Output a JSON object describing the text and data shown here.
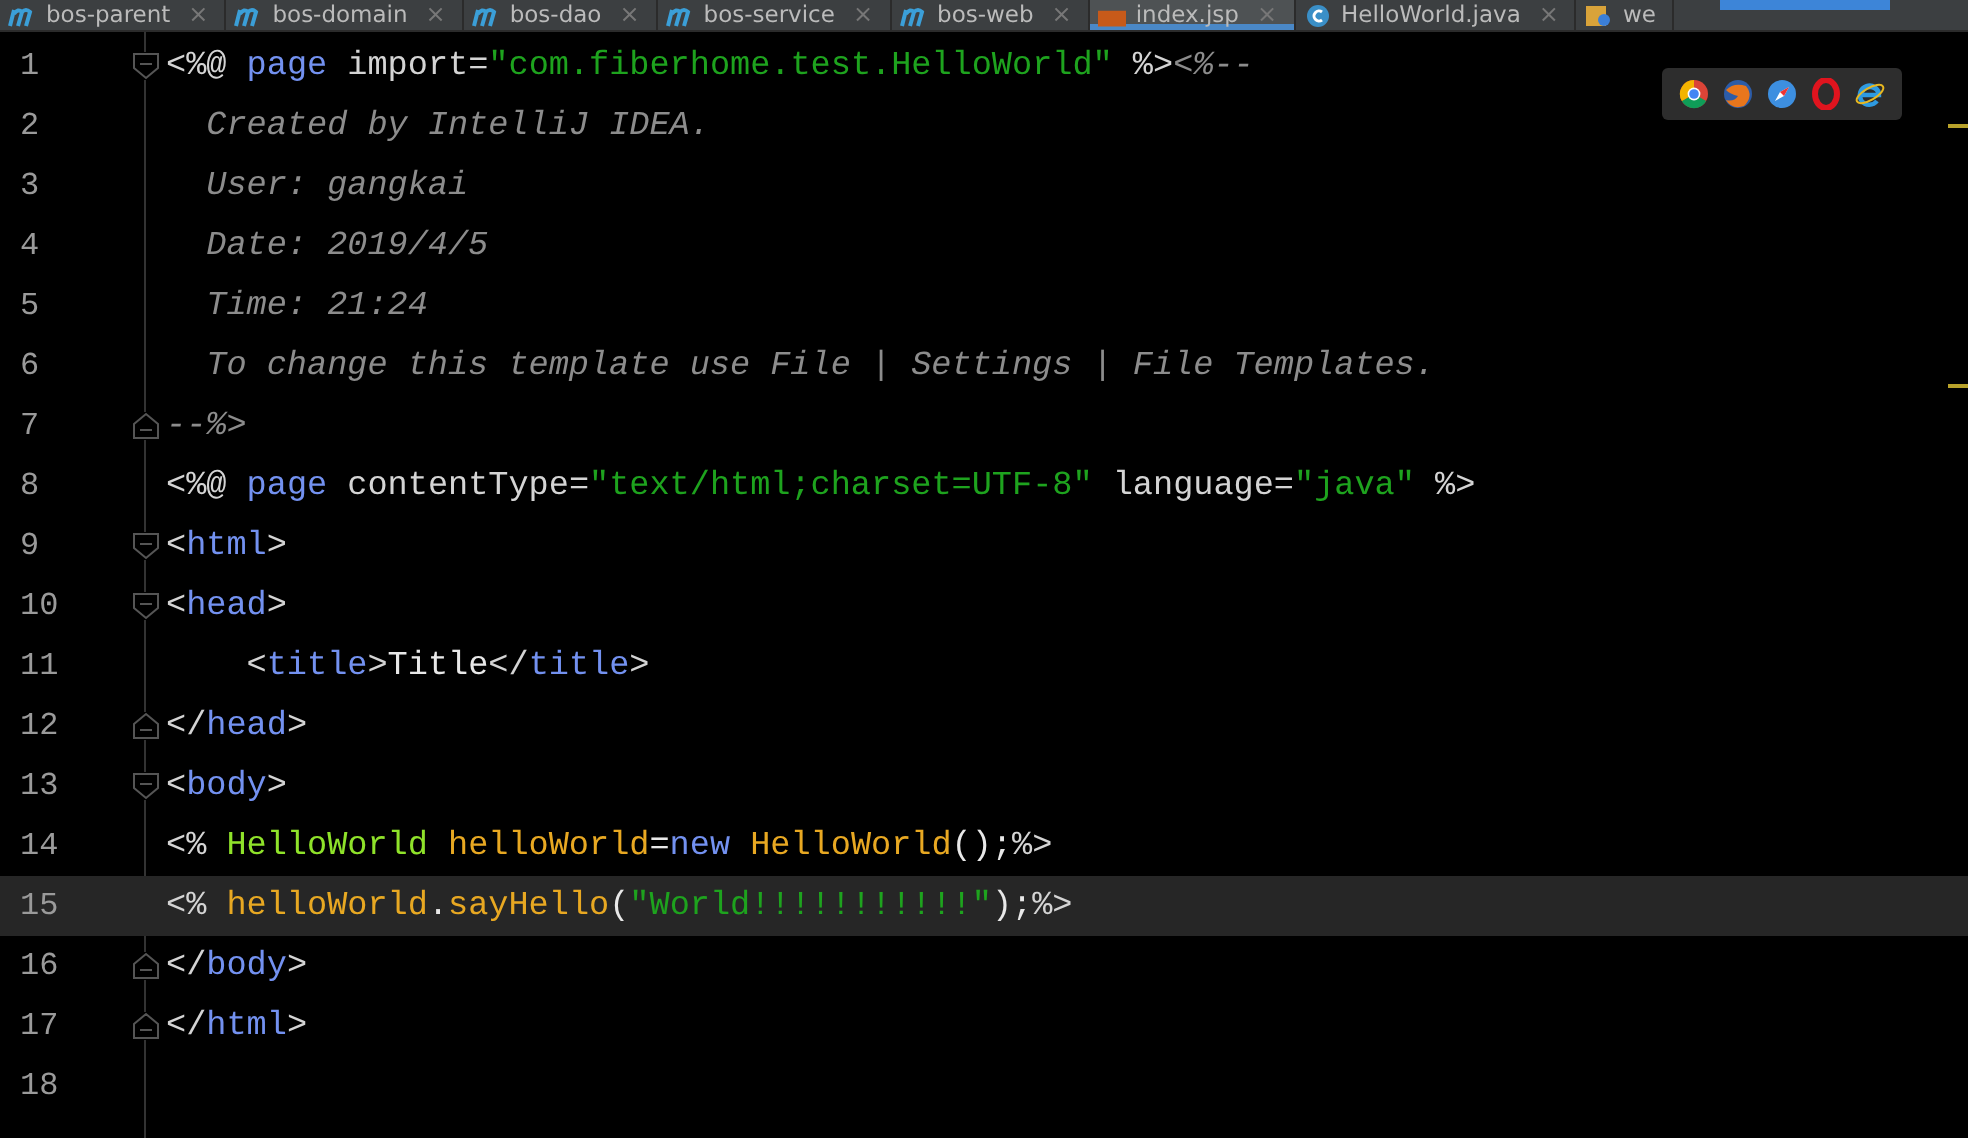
{
  "tabs": [
    {
      "label": "bos-parent",
      "kind": "module",
      "close": "×",
      "selected": false
    },
    {
      "label": "bos-domain",
      "kind": "module",
      "close": "×",
      "selected": false
    },
    {
      "label": "bos-dao",
      "kind": "module",
      "close": "×",
      "selected": false
    },
    {
      "label": "bos-service",
      "kind": "module",
      "close": "×",
      "selected": false
    },
    {
      "label": "bos-web",
      "kind": "module",
      "close": "×",
      "selected": false
    },
    {
      "label": "index.jsp",
      "kind": "jsp",
      "close": "×",
      "selected": true
    },
    {
      "label": "HelloWorld.java",
      "kind": "class",
      "close": "×",
      "selected": false
    },
    {
      "label": "we",
      "kind": "xml",
      "selected": false
    }
  ],
  "lines": [
    {
      "number": "1",
      "kind": "foldopen",
      "current": false,
      "tokens": [
        {
          "t": "<%@ ",
          "kind": "tag"
        },
        {
          "t": "page",
          "kind": "kw"
        },
        {
          "t": " import=",
          "kind": "attr"
        },
        {
          "t": "\"com.fiberhome.test.HelloWorld\"",
          "kind": "str"
        },
        {
          "t": " %>",
          "kind": "tag"
        },
        {
          "t": "<%--",
          "kind": "cmt"
        }
      ]
    },
    {
      "number": "2",
      "kind": "plain",
      "current": false,
      "tokens": [
        {
          "t": "  Created by IntelliJ IDEA.",
          "kind": "cmt"
        }
      ]
    },
    {
      "number": "3",
      "kind": "plain",
      "current": false,
      "tokens": [
        {
          "t": "  User: gangkai",
          "kind": "cmt"
        }
      ]
    },
    {
      "number": "4",
      "kind": "plain",
      "current": false,
      "tokens": [
        {
          "t": "  Date: 2019/4/5",
          "kind": "cmt"
        }
      ]
    },
    {
      "number": "5",
      "kind": "plain",
      "current": false,
      "tokens": [
        {
          "t": "  Time: 21:24",
          "kind": "cmt"
        }
      ]
    },
    {
      "number": "6",
      "kind": "plain",
      "current": false,
      "tokens": [
        {
          "t": "  To change this template use File | Settings | File Templates.",
          "kind": "cmt"
        }
      ]
    },
    {
      "number": "7",
      "kind": "foldclose",
      "current": false,
      "tokens": [
        {
          "t": "--%>",
          "kind": "cmt"
        }
      ]
    },
    {
      "number": "8",
      "kind": "plain",
      "current": false,
      "tokens": [
        {
          "t": "<%@ ",
          "kind": "tag"
        },
        {
          "t": "page",
          "kind": "kw"
        },
        {
          "t": " contentType=",
          "kind": "attr"
        },
        {
          "t": "\"text/html;charset=UTF-8\"",
          "kind": "str"
        },
        {
          "t": " language=",
          "kind": "attr"
        },
        {
          "t": "\"java\"",
          "kind": "str"
        },
        {
          "t": " %>",
          "kind": "tag"
        }
      ]
    },
    {
      "number": "9",
      "kind": "foldopen",
      "current": false,
      "tokens": [
        {
          "t": "<",
          "kind": "tag"
        },
        {
          "t": "html",
          "kind": "kw"
        },
        {
          "t": ">",
          "kind": "tag"
        }
      ]
    },
    {
      "number": "10",
      "kind": "foldopen",
      "current": false,
      "tokens": [
        {
          "t": "<",
          "kind": "tag"
        },
        {
          "t": "head",
          "kind": "kw"
        },
        {
          "t": ">",
          "kind": "tag"
        }
      ]
    },
    {
      "number": "11",
      "kind": "plain",
      "current": false,
      "tokens": [
        {
          "t": "    <",
          "kind": "tag"
        },
        {
          "t": "title",
          "kind": "kw"
        },
        {
          "t": ">",
          "kind": "tag"
        },
        {
          "t": "Title",
          "kind": "text"
        },
        {
          "t": "</",
          "kind": "tag"
        },
        {
          "t": "title",
          "kind": "kw"
        },
        {
          "t": ">",
          "kind": "tag"
        }
      ]
    },
    {
      "number": "12",
      "kind": "foldclose",
      "current": false,
      "tokens": [
        {
          "t": "</",
          "kind": "tag"
        },
        {
          "t": "head",
          "kind": "kw"
        },
        {
          "t": ">",
          "kind": "tag"
        }
      ]
    },
    {
      "number": "13",
      "kind": "foldopen",
      "current": false,
      "tokens": [
        {
          "t": "<",
          "kind": "tag"
        },
        {
          "t": "body",
          "kind": "kw"
        },
        {
          "t": ">",
          "kind": "tag"
        }
      ]
    },
    {
      "number": "14",
      "kind": "plain",
      "current": false,
      "tokens": [
        {
          "t": "<% ",
          "kind": "tag"
        },
        {
          "t": "HelloWorld",
          "kind": "cls"
        },
        {
          "t": " helloWorld",
          "kind": "var"
        },
        {
          "t": "=",
          "kind": "text"
        },
        {
          "t": "new",
          "kind": "kw"
        },
        {
          "t": " HelloWorld",
          "kind": "var"
        },
        {
          "t": "();",
          "kind": "text"
        },
        {
          "t": "%>",
          "kind": "tag"
        }
      ]
    },
    {
      "number": "15",
      "kind": "plain",
      "current": true,
      "tokens": [
        {
          "t": "<% ",
          "kind": "tag"
        },
        {
          "t": "helloWorld",
          "kind": "var"
        },
        {
          "t": ".",
          "kind": "text"
        },
        {
          "t": "sayHello",
          "kind": "var"
        },
        {
          "t": "(",
          "kind": "text"
        },
        {
          "t": "\"World!!!!!!!!!!!\"",
          "kind": "str"
        },
        {
          "t": ");",
          "kind": "text"
        },
        {
          "t": "%>",
          "kind": "tag"
        }
      ]
    },
    {
      "number": "16",
      "kind": "foldclose",
      "current": false,
      "tokens": [
        {
          "t": "</",
          "kind": "tag"
        },
        {
          "t": "body",
          "kind": "kw"
        },
        {
          "t": ">",
          "kind": "tag"
        }
      ]
    },
    {
      "number": "17",
      "kind": "foldclose",
      "current": false,
      "tokens": [
        {
          "t": "</",
          "kind": "tag"
        },
        {
          "t": "html",
          "kind": "kw"
        },
        {
          "t": ">",
          "kind": "tag"
        }
      ]
    },
    {
      "number": "18",
      "kind": "plain",
      "current": false
    }
  ]
}
